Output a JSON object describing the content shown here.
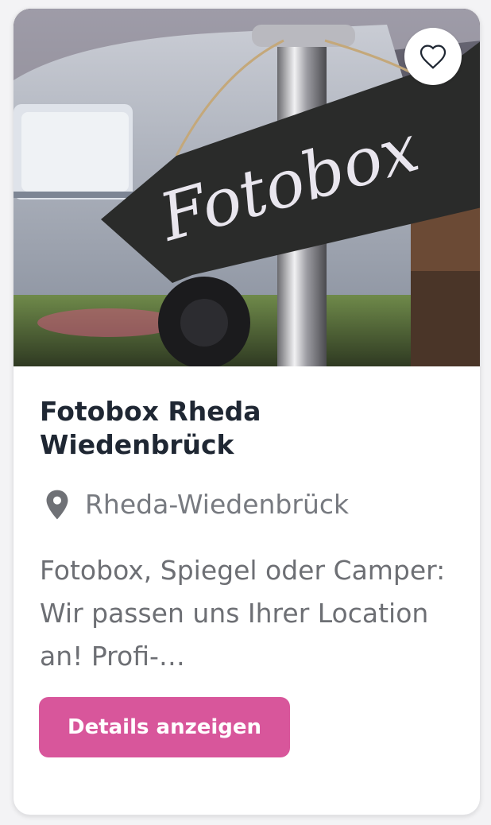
{
  "listing": {
    "photo_alt": "Fotobox",
    "sign_text": "Fotobox",
    "favorite_icon": "heart-outline-icon",
    "title": "Fotobox Rheda Wiedenbrück",
    "location_icon": "map-pin-icon",
    "location": "Rheda-Wiedenbrück",
    "description": "Fotobox, Spiegel oder Camper: Wir passen uns Ihrer Location an! Profi-…",
    "button_label": "Details anzeigen"
  },
  "colors": {
    "accent": "#d8569b",
    "title": "#1f2733",
    "muted": "#777a80",
    "card": "#ffffff"
  }
}
